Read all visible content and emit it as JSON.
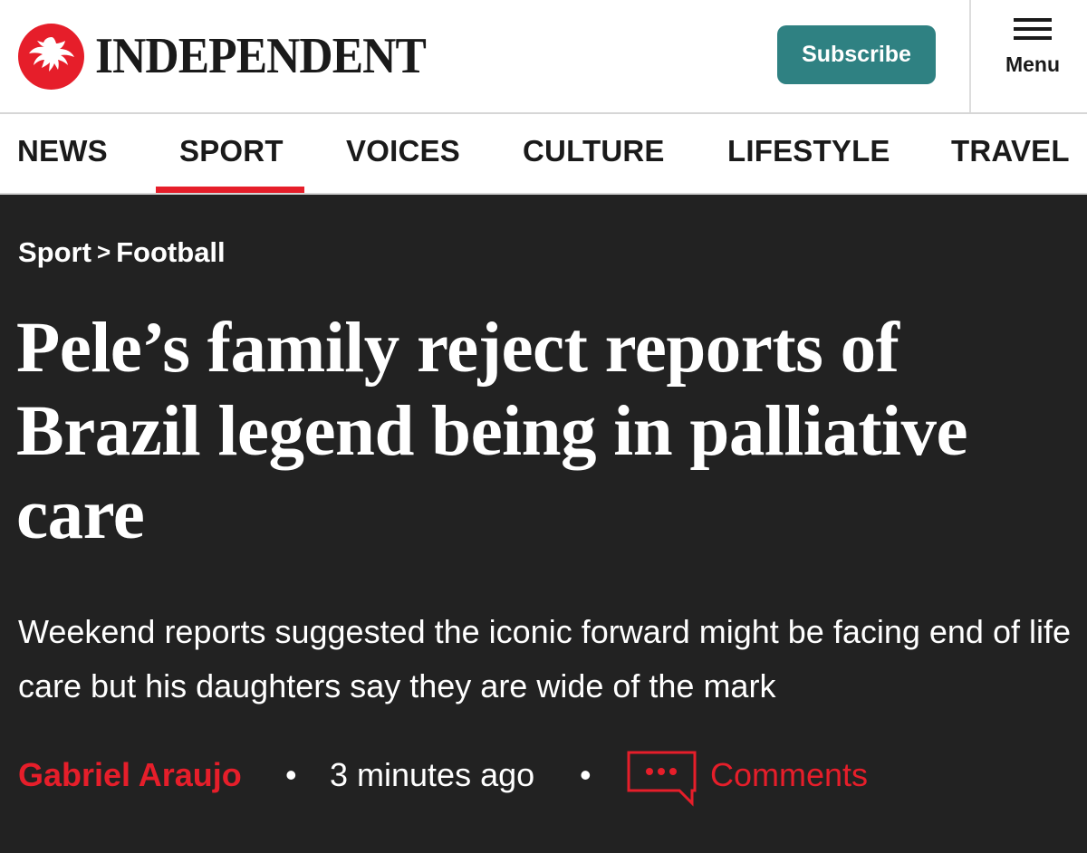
{
  "header": {
    "logo_text": "INDEPENDENT",
    "subscribe_label": "Subscribe",
    "menu_label": "Menu",
    "colors": {
      "brand_red": "#e61e2a",
      "subscribe_teal": "#2f8182"
    }
  },
  "nav": {
    "items": [
      {
        "label": "NEWS"
      },
      {
        "label": "SPORT",
        "active": true
      },
      {
        "label": "VOICES"
      },
      {
        "label": "CULTURE"
      },
      {
        "label": "LIFESTYLE"
      },
      {
        "label": "TRAVEL"
      }
    ]
  },
  "article": {
    "breadcrumb": {
      "section": "Sport",
      "separator": ">",
      "subsection": "Football"
    },
    "headline": "Pele’s family reject reports of Brazil legend being in palliative care",
    "standfirst": "Weekend reports suggested the iconic forward might be facing end of life care but his daughters say they are wide of the mark",
    "byline": {
      "author": "Gabriel Araujo",
      "separator": "•",
      "time": "3 minutes ago",
      "comments_label": "Comments"
    }
  }
}
